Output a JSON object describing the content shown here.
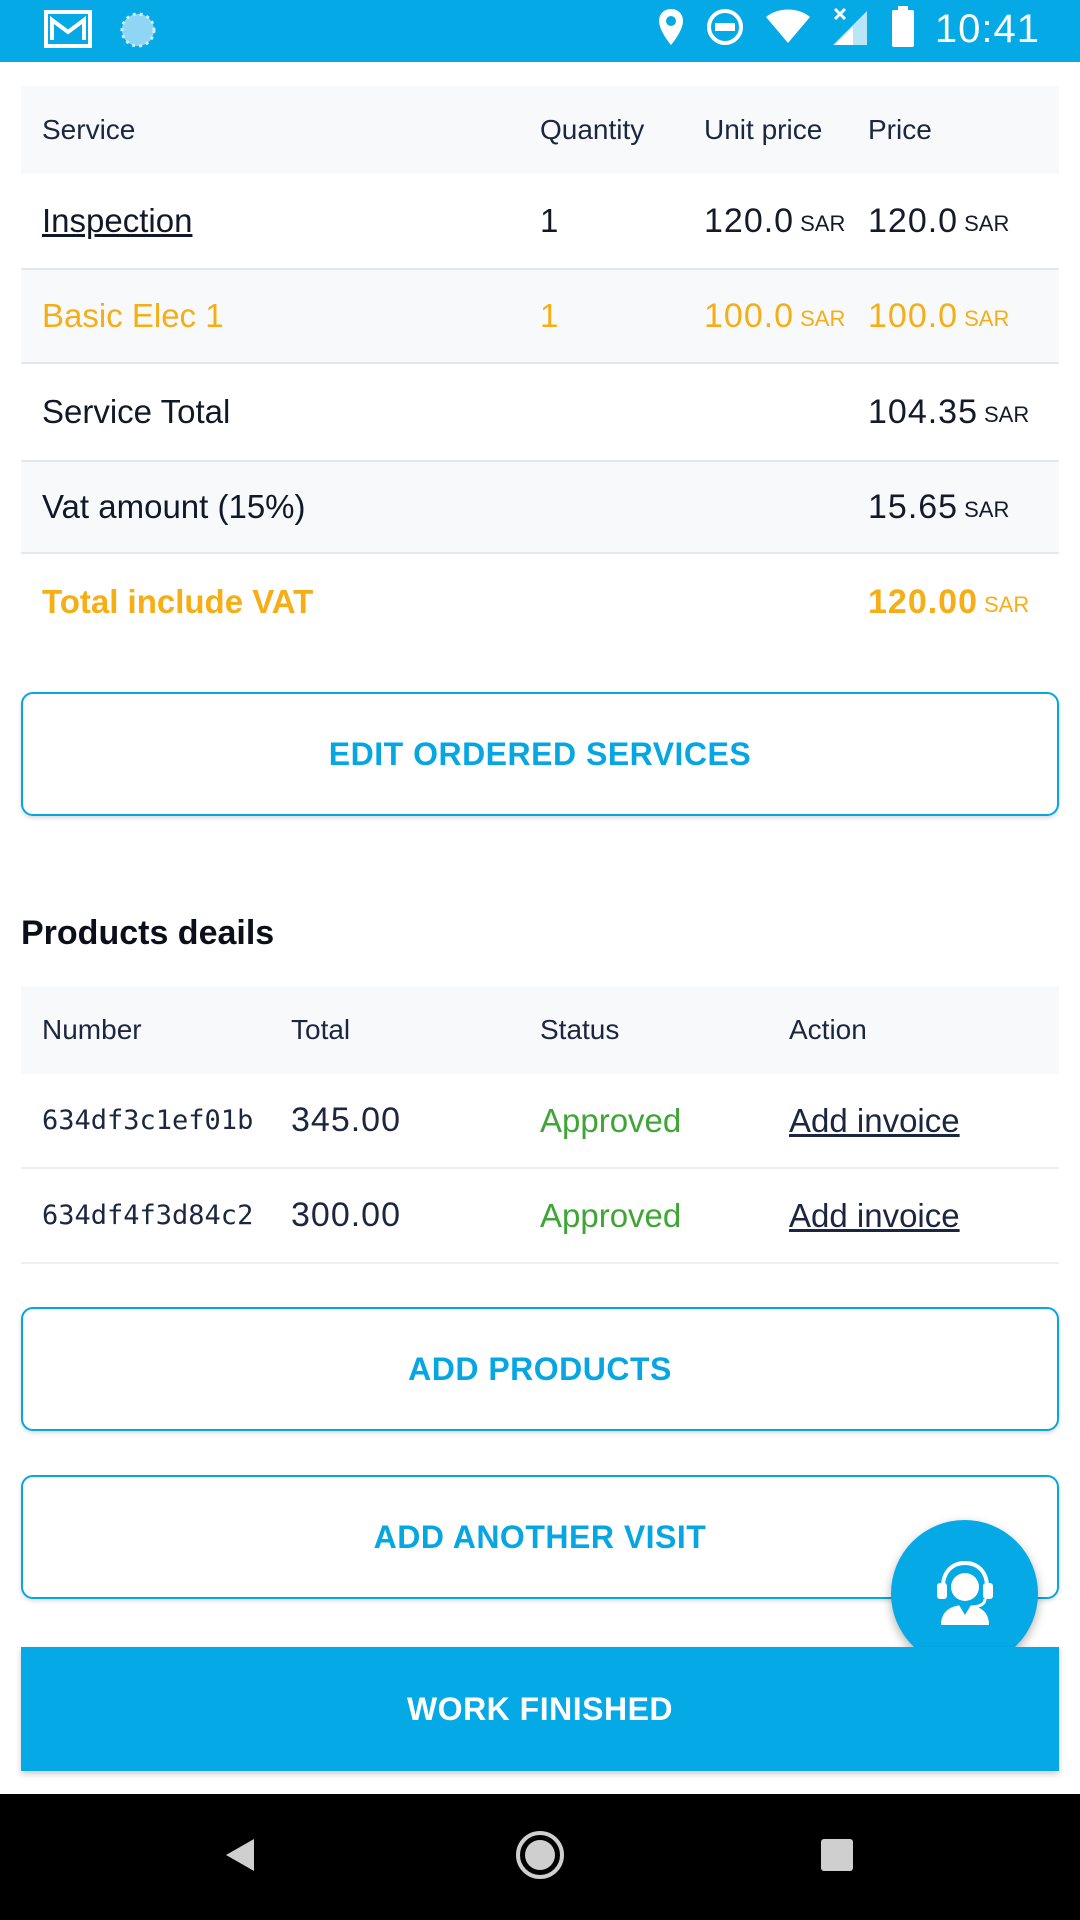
{
  "status_bar": {
    "time": "10:41",
    "left_icons": [
      "gmail-icon",
      "loading-icon"
    ],
    "right_icons": [
      "location-icon",
      "do-not-disturb-icon",
      "wifi-icon",
      "signal-icon",
      "battery-icon"
    ]
  },
  "services_table": {
    "headers": {
      "service": "Service",
      "quantity": "Quantity",
      "unit_price": "Unit price",
      "price": "Price"
    },
    "rows": [
      {
        "service": "Inspection",
        "quantity": "1",
        "unit_price": "120.0",
        "unit_currency": "SAR",
        "price": "120.0",
        "price_currency": "SAR"
      },
      {
        "service": "Basic Elec 1",
        "quantity": "1",
        "unit_price": "100.0",
        "unit_currency": "SAR",
        "price": "100.0",
        "price_currency": "SAR"
      }
    ],
    "service_total": {
      "label": "Service Total",
      "value": "104.35",
      "currency": "SAR"
    },
    "vat": {
      "label": "Vat amount (15%)",
      "value": "15.65",
      "currency": "SAR"
    },
    "total_vat": {
      "label": "Total include VAT",
      "value": "120.00",
      "currency": "SAR"
    }
  },
  "edit_services_button": "EDIT ORDERED SERVICES",
  "products": {
    "title": "Products deails",
    "headers": {
      "number": "Number",
      "total": "Total",
      "status": "Status",
      "action": "Action"
    },
    "rows": [
      {
        "number": "634df3c1ef01b",
        "total": "345.00",
        "status": "Approved",
        "action": "Add invoice"
      },
      {
        "number": "634df4f3d84c2",
        "total": "300.00",
        "status": "Approved",
        "action": "Add invoice"
      }
    ]
  },
  "add_products_button": "ADD PRODUCTS",
  "add_visit_button": "ADD ANOTHER VISIT",
  "support_fab_icon": "support-agent-icon",
  "work_finished_button": "WORK FINISHED",
  "nav_bar": {
    "icons": [
      "back-icon",
      "home-icon",
      "recents-icon"
    ]
  },
  "colors": {
    "primary": "#05a9e6",
    "highlight": "#f6ae16",
    "approved": "#3fa535",
    "text_dark": "#1d2640"
  }
}
